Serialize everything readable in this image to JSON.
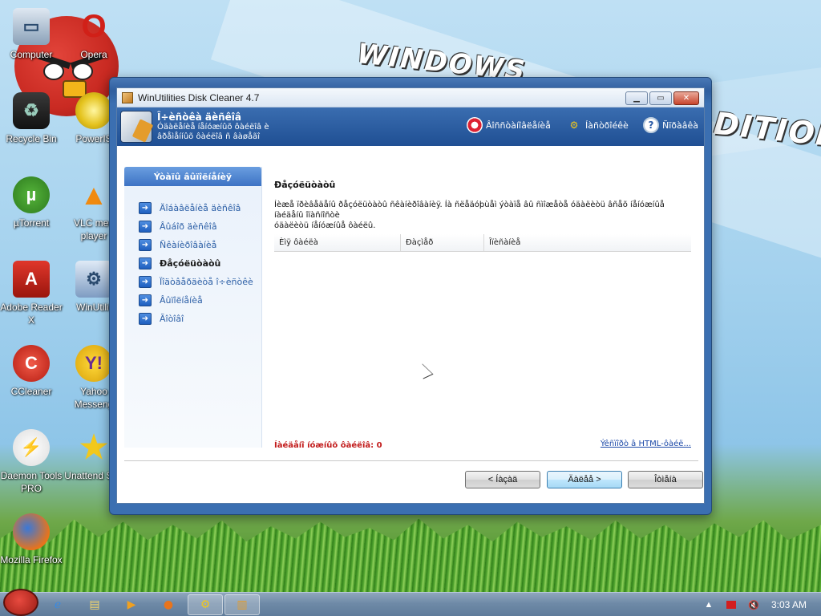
{
  "desktop": {
    "wallpaper_text_1": "WINDOWS",
    "wallpaper_text_2": "DITION",
    "icons": [
      {
        "label": "Computer",
        "glyph": "computer-icon"
      },
      {
        "label": "Opera",
        "glyph": "opera-icon"
      },
      {
        "label": "Recycle Bin",
        "glyph": "recycle-bin-icon"
      },
      {
        "label": "PowerIS",
        "glyph": "poweriso-icon"
      },
      {
        "label": "µTorrent",
        "glyph": "utorrent-icon"
      },
      {
        "label": "VLC med player",
        "glyph": "vlc-icon"
      },
      {
        "label": "Adobe Reader X",
        "glyph": "adobe-reader-icon"
      },
      {
        "label": "WinUtilit",
        "glyph": "winutilities-icon"
      },
      {
        "label": "CCleaner",
        "glyph": "ccleaner-icon"
      },
      {
        "label": "Yahoo Messeng",
        "glyph": "yahoo-messenger-icon"
      },
      {
        "label": "Daemon Tools PRO",
        "glyph": "daemon-tools-icon"
      },
      {
        "label": "Unattend Soft",
        "glyph": "unattend-soft-icon"
      },
      {
        "label": "Mozilla Firefox",
        "glyph": "firefox-icon"
      }
    ]
  },
  "window": {
    "title": "WinUtilities Disk Cleaner 4.7",
    "header": {
      "title": "Î÷èñòêà äèñêîâ",
      "subtitle_line1": "Óäàëåíèå íåíóæíûõ ôàéëîâ è",
      "subtitle_line2": "âðåìåííûõ ôàéëîâ ñ âàøåãî"
    },
    "toolbar": {
      "support_label": "Âîññòàíîâëåíèå",
      "settings_label": "Íàñòðîéêè",
      "help_label": "Ñïðàâêà"
    },
    "left_nav": {
      "header": "Ýòàïû âûïîëíåíèÿ",
      "items": [
        {
          "label": "Äîáàâëåíèå äèñêîâ"
        },
        {
          "label": "Âûáîð äèñêîâ"
        },
        {
          "label": "Ñêàíèðîâàíèå"
        },
        {
          "label": "Ðåçóëüòàòû"
        },
        {
          "label": "Ïîäòâåðäèòå î÷èñòêè"
        },
        {
          "label": "Âûïîëíåíèå"
        },
        {
          "label": "Ãîòîâî"
        }
      ],
      "active_index": 3
    },
    "main": {
      "title": "Ðåçóëüòàòû",
      "description_line1": "Íèæå ïðèâåäåíû ðåçóëüòàòû ñêàíèðîâàíèÿ. Íà ñëåäóþùåì ýòàïå âû ñìîæåòå óäàëèòü âñåõ íåíóæíûå íàéäåíû îïàñíîñòè",
      "description_line2": "óäàëèòü íåíóæíûå ôàéëû.",
      "columns": [
        "Èìÿ ôàéëà",
        "Ðàçìåð",
        "Îïèñàíèå"
      ],
      "error_count_label": "Íàéäåíî íóæíûõ ôàéëîâ: 0",
      "export_link": "Ýêñïîðò â HTML-ôàéë..."
    },
    "buttons": {
      "back": "< Íàçàä",
      "next": "Äàëåå >",
      "cancel": "Îòìåíà"
    }
  },
  "taskbar": {
    "clock": "3:03 AM"
  }
}
